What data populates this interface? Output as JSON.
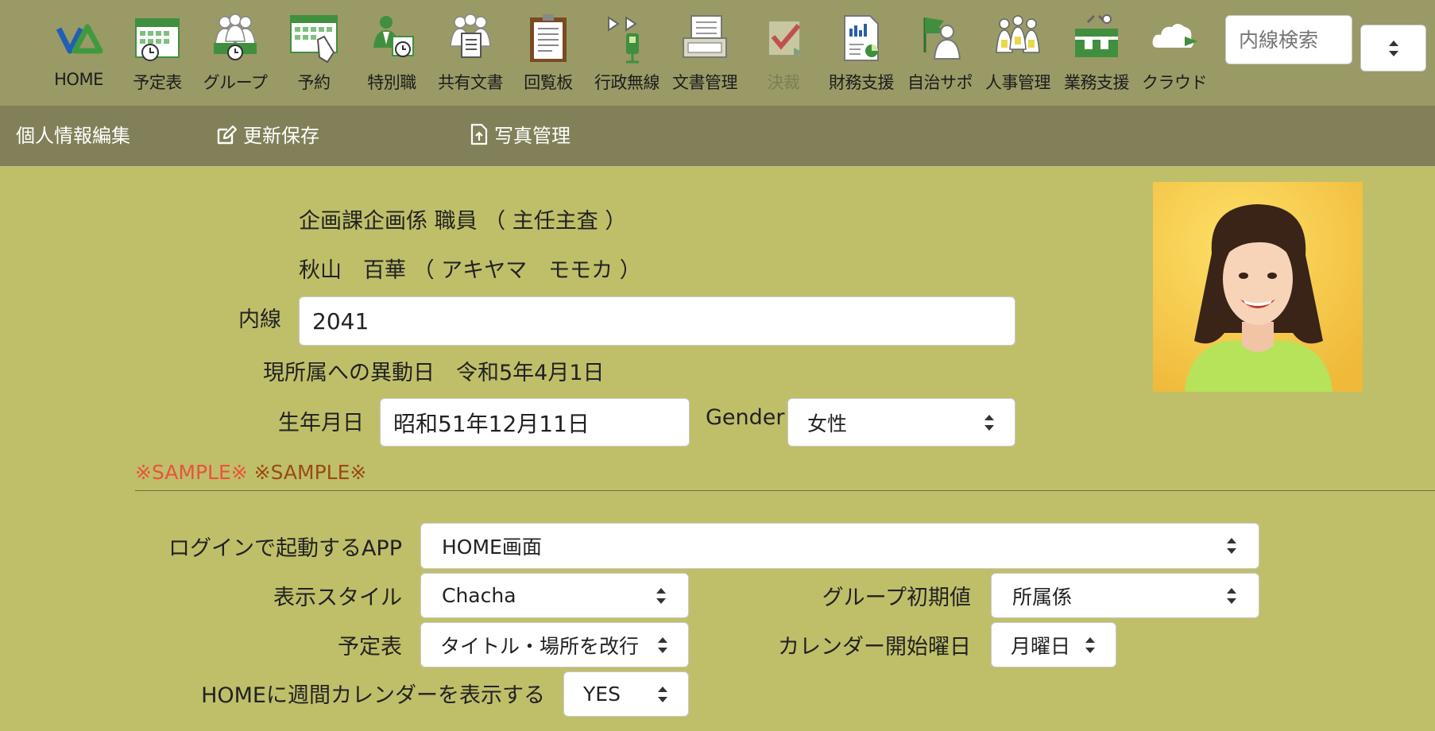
{
  "toolbar": {
    "apps": [
      {
        "label": "HOME",
        "icon": "logo-icon",
        "disabled": false
      },
      {
        "label": "予定表",
        "icon": "calendar-icon",
        "disabled": false
      },
      {
        "label": "グループ",
        "icon": "group-icon",
        "disabled": false
      },
      {
        "label": "予約",
        "icon": "reservation-icon",
        "disabled": false
      },
      {
        "label": "特別職",
        "icon": "special-staff-icon",
        "disabled": false
      },
      {
        "label": "共有文書",
        "icon": "shared-docs-icon",
        "disabled": false
      },
      {
        "label": "回覧板",
        "icon": "clipboard-icon",
        "disabled": false
      },
      {
        "label": "行政無線",
        "icon": "radio-icon",
        "disabled": false
      },
      {
        "label": "文書管理",
        "icon": "document-management-icon",
        "disabled": false
      },
      {
        "label": "決裁",
        "icon": "approval-check-icon",
        "disabled": true
      },
      {
        "label": "財務支援",
        "icon": "finance-chart-icon",
        "disabled": false
      },
      {
        "label": "自治サポ",
        "icon": "flag-person-icon",
        "disabled": false
      },
      {
        "label": "人事管理",
        "icon": "personnel-icon",
        "disabled": false
      },
      {
        "label": "業務支援",
        "icon": "toolbox-icon",
        "disabled": false
      },
      {
        "label": "クラウド",
        "icon": "cloud-icon",
        "disabled": false
      }
    ],
    "search_placeholder": "内線検索"
  },
  "submenu": {
    "title": "個人情報編集",
    "save_label": "更新保存",
    "photo_label": "写真管理"
  },
  "profile": {
    "department": "企画課企画係 職員 （ 主任主査 ）",
    "name": "秋山　百華 （ アキヤマ　モモカ ）",
    "extension_label": "内線",
    "extension_value": "2041",
    "transfer_label": "現所属への異動日",
    "transfer_date": "令和5年4月1日",
    "birth_label": "生年月日",
    "birth_value": "昭和51年12月11日",
    "gender_label": "Gender",
    "gender_value": "女性",
    "sample_1": "※SAMPLE※",
    "sample_2": "※SAMPLE※"
  },
  "settings": {
    "login_app_label": "ログインで起動するAPP",
    "login_app_value": "HOME画面",
    "display_style_label": "表示スタイル",
    "display_style_value": "Chacha",
    "group_default_label": "グループ初期値",
    "group_default_value": "所属係",
    "schedule_label": "予定表",
    "schedule_value": "タイトル・場所を改行",
    "calendar_start_label": "カレンダー開始曜日",
    "calendar_start_value": "月曜日",
    "home_weekly_label": "HOMEに週間カレンダーを表示する",
    "home_weekly_value": "YES"
  },
  "colors": {
    "toolbar_bg": "#999a66",
    "submenu_bg": "#818059",
    "content_bg": "#bfbf6a",
    "icon_green": "#3f8f3f",
    "sample_red": "#e8543c",
    "sample_brown": "#9a4a14"
  }
}
